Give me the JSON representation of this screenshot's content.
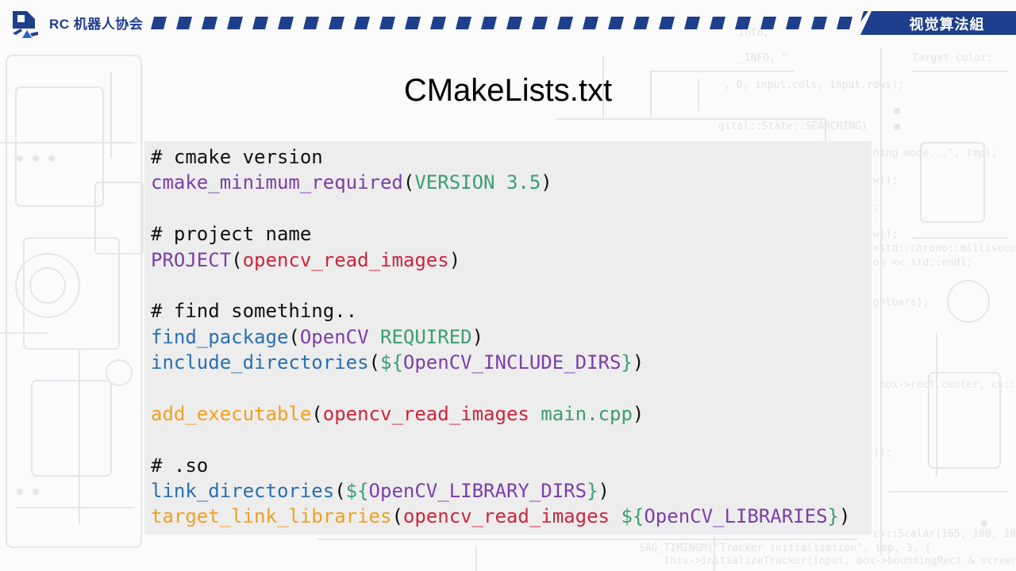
{
  "header": {
    "org_name": "RC 机器人协会",
    "group_label": "视觉算法組"
  },
  "slide": {
    "title": "CMakeLists.txt"
  },
  "code": {
    "lines": [
      [
        {
          "t": "# cmake version",
          "c": "comment"
        }
      ],
      [
        {
          "t": "cmake_minimum_required",
          "c": "purple"
        },
        {
          "t": "(",
          "c": "punct"
        },
        {
          "t": "VERSION 3.5",
          "c": "green"
        },
        {
          "t": ")",
          "c": "punct"
        }
      ],
      [],
      [
        {
          "t": "# project name",
          "c": "comment"
        }
      ],
      [
        {
          "t": "PROJECT",
          "c": "purple"
        },
        {
          "t": "(",
          "c": "punct"
        },
        {
          "t": "opencv_read_images",
          "c": "red"
        },
        {
          "t": ")",
          "c": "punct"
        }
      ],
      [],
      [
        {
          "t": "# find something..",
          "c": "comment"
        }
      ],
      [
        {
          "t": "find_package",
          "c": "blue"
        },
        {
          "t": "(",
          "c": "punct"
        },
        {
          "t": "OpenCV",
          "c": "purple"
        },
        {
          "t": " ",
          "c": "punct"
        },
        {
          "t": "REQUIRED",
          "c": "green"
        },
        {
          "t": ")",
          "c": "punct"
        }
      ],
      [
        {
          "t": "include_directories",
          "c": "blue"
        },
        {
          "t": "(",
          "c": "punct"
        },
        {
          "t": "${",
          "c": "green"
        },
        {
          "t": "OpenCV_INCLUDE_DIRS",
          "c": "purple"
        },
        {
          "t": "}",
          "c": "green"
        },
        {
          "t": ")",
          "c": "punct"
        }
      ],
      [],
      [
        {
          "t": "add_executable",
          "c": "orange"
        },
        {
          "t": "(",
          "c": "punct"
        },
        {
          "t": "opencv_read_images",
          "c": "red"
        },
        {
          "t": " ",
          "c": "punct"
        },
        {
          "t": "main.cpp",
          "c": "green"
        },
        {
          "t": ")",
          "c": "punct"
        }
      ],
      [],
      [
        {
          "t": "# .so",
          "c": "comment"
        }
      ],
      [
        {
          "t": "link_directories",
          "c": "blue"
        },
        {
          "t": "(",
          "c": "punct"
        },
        {
          "t": "${",
          "c": "green"
        },
        {
          "t": "OpenCV_LIBRARY_DIRS",
          "c": "purple"
        },
        {
          "t": "}",
          "c": "green"
        },
        {
          "t": ")",
          "c": "punct"
        }
      ],
      [
        {
          "t": "target_link_libraries",
          "c": "orange"
        },
        {
          "t": "(",
          "c": "punct"
        },
        {
          "t": "opencv_read_images",
          "c": "red"
        },
        {
          "t": " ",
          "c": "punct"
        },
        {
          "t": "${",
          "c": "green"
        },
        {
          "t": "OpenCV_LIBRARIES",
          "c": "purple"
        },
        {
          "t": "}",
          "c": "green"
        },
        {
          "t": ")",
          "c": "punct"
        }
      ]
    ]
  },
  "background_code": [
    "info,",
    "_INFO, \"                    Target color:",
    ", 0, input.cols, input.rows);",
    "gital::State::SEARCHING)",
    "hing mode...\", tmp);",
    "w();",
    ";",
    "w();",
    "<std::chrono::millisecon",
    "on << std::endl;",
    "ghtbars);",
    " box->rect.center, cv::",
    "));",
    "cv::Scalar(165, 100, 10",
    "SAG_TIMINGM(\"Tracker initialization\", tmp, 3, {",
    "    this->initializeTracker(input, box->boundingRect & screen"
  ],
  "colors": {
    "brand_blue": "#1e3f8c",
    "code_bg": "#ededee",
    "comment": "#111111",
    "purple": "#7b3fa8",
    "blue": "#2a6fb0",
    "orange": "#f0a020",
    "red": "#d0243c",
    "green": "#3a9e72"
  },
  "icons": {
    "logo": "rc-association-logo-icon",
    "stripe_band": "diagonal-stripe-decoration"
  }
}
